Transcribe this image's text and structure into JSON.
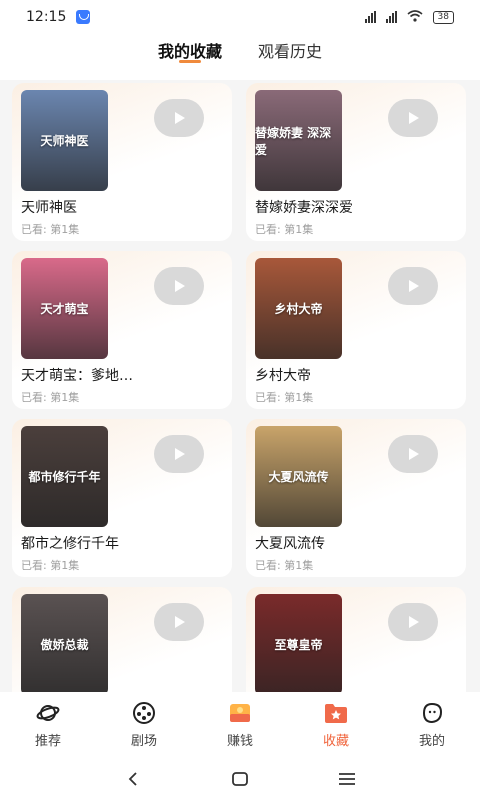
{
  "status_bar": {
    "time": "12:15",
    "battery": "38"
  },
  "tabs": [
    {
      "label": "我的收藏",
      "active": true
    },
    {
      "label": "观看历史",
      "active": false
    }
  ],
  "favorites": [
    {
      "title": "天师神医",
      "progress": "已看: 第1集",
      "poster_text": "天师神医",
      "poster_color": "#6b86b0"
    },
    {
      "title": "替嫁娇妻深深爱",
      "progress": "已看: 第1集",
      "poster_text": "替嫁娇妻 深深爱",
      "poster_color": "#8a6a78"
    },
    {
      "title": "天才萌宝：爹地…",
      "progress": "已看: 第1集",
      "poster_text": "天才萌宝",
      "poster_color": "#d96a8a"
    },
    {
      "title": "乡村大帝",
      "progress": "已看: 第1集",
      "poster_text": "乡村大帝",
      "poster_color": "#a8583a"
    },
    {
      "title": "都市之修行千年",
      "progress": "已看: 第1集",
      "poster_text": "都市修行千年",
      "poster_color": "#4b3f3c"
    },
    {
      "title": "大夏风流传",
      "progress": "已看: 第1集",
      "poster_text": "大夏风流传",
      "poster_color": "#c9a46a"
    },
    {
      "title": "",
      "progress": "",
      "poster_text": "傲娇总裁",
      "poster_color": "#5a5252"
    },
    {
      "title": "",
      "progress": "",
      "poster_text": "至尊皇帝",
      "poster_color": "#7a2a2a"
    }
  ],
  "bottom_nav": [
    {
      "label": "推荐",
      "icon": "planet-icon"
    },
    {
      "label": "剧场",
      "icon": "film-reel-icon"
    },
    {
      "label": "赚钱",
      "icon": "coin-icon"
    },
    {
      "label": "收藏",
      "icon": "folder-star-icon",
      "active": true
    },
    {
      "label": "我的",
      "icon": "profile-icon"
    }
  ],
  "colors": {
    "accent": "#f08a3c",
    "active_nav": "#f0643c",
    "subtitle": "#a0a0a0"
  }
}
